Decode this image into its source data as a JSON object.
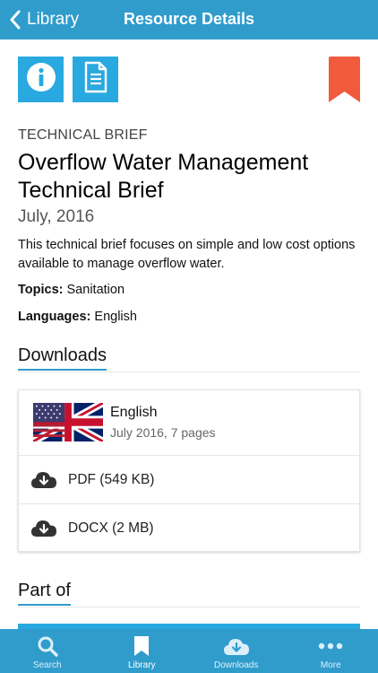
{
  "header": {
    "back_label": "Library",
    "title": "Resource Details"
  },
  "actions": {
    "info_icon": "info-icon",
    "document_icon": "document-icon",
    "bookmark_icon": "bookmark-icon"
  },
  "resource": {
    "category": "TECHNICAL BRIEF",
    "title": "Overflow Water Management Technical Brief",
    "date": "July, 2016",
    "description": "This technical brief focuses on simple and low cost options available to manage overflow water.",
    "topics_label": "Topics:",
    "topics_value": "Sanitation",
    "languages_label": "Languages:",
    "languages_value": "English"
  },
  "downloads": {
    "heading": "Downloads",
    "language": {
      "name": "English",
      "details": "July 2016, 7 pages",
      "flag_icon": "uk-flag-icon"
    },
    "files": [
      {
        "label": "PDF (549 KB)",
        "icon": "cloud-download-icon"
      },
      {
        "label": "DOCX (2 MB)",
        "icon": "cloud-download-icon"
      }
    ]
  },
  "part_of": {
    "heading": "Part of"
  },
  "tabbar": {
    "tabs": [
      {
        "label": "Search",
        "icon": "search-icon"
      },
      {
        "label": "Library",
        "icon": "bookmark-icon"
      },
      {
        "label": "Downloads",
        "icon": "cloud-download-icon"
      },
      {
        "label": "More",
        "icon": "more-dots-icon"
      }
    ],
    "active": "Library"
  },
  "colors": {
    "primary": "#2f9ccc",
    "icon_tile": "#29a9e0",
    "bookmark": "#f15a3c"
  }
}
